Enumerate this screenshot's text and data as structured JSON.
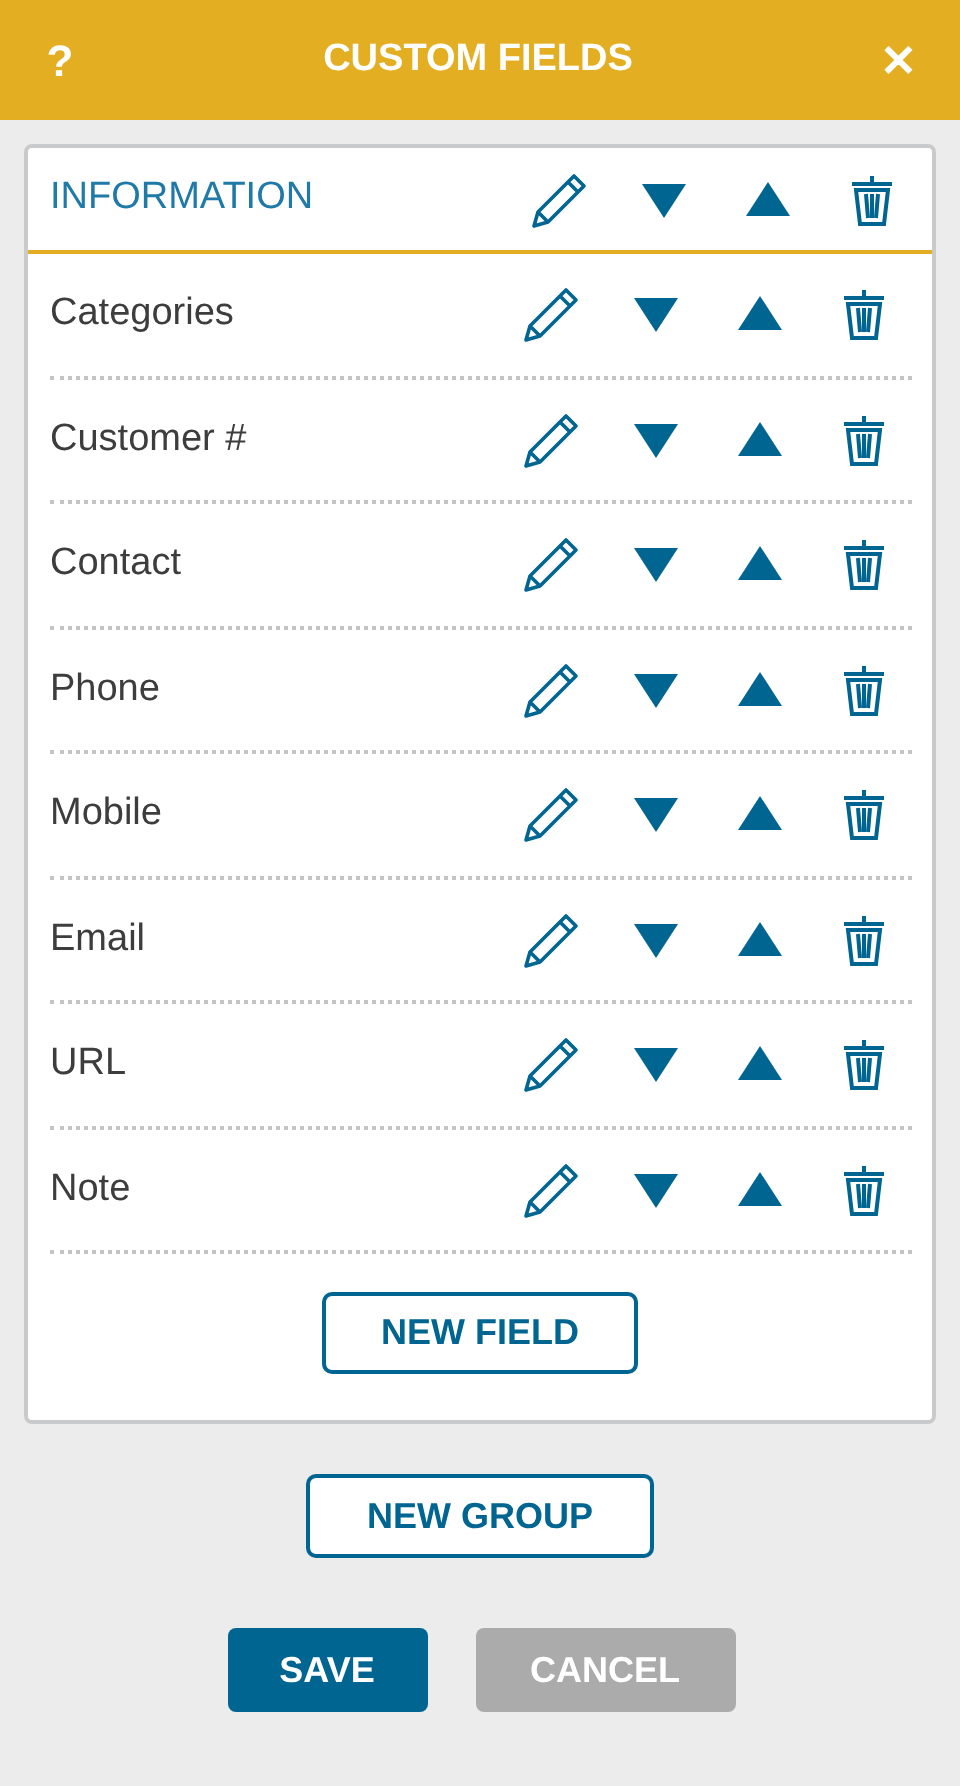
{
  "header": {
    "help": "?",
    "title": "CUSTOM FIELDS",
    "close": "✕"
  },
  "group": {
    "title": "INFORMATION",
    "fields": [
      {
        "label": "Categories"
      },
      {
        "label": "Customer #"
      },
      {
        "label": "Contact"
      },
      {
        "label": "Phone"
      },
      {
        "label": "Mobile"
      },
      {
        "label": "Email"
      },
      {
        "label": "URL"
      },
      {
        "label": "Note"
      }
    ],
    "new_field": "NEW FIELD"
  },
  "new_group": "NEW GROUP",
  "footer": [
    {
      "label": "SAVE",
      "disabled": false
    },
    {
      "label": "CANCEL",
      "disabled": true
    }
  ]
}
